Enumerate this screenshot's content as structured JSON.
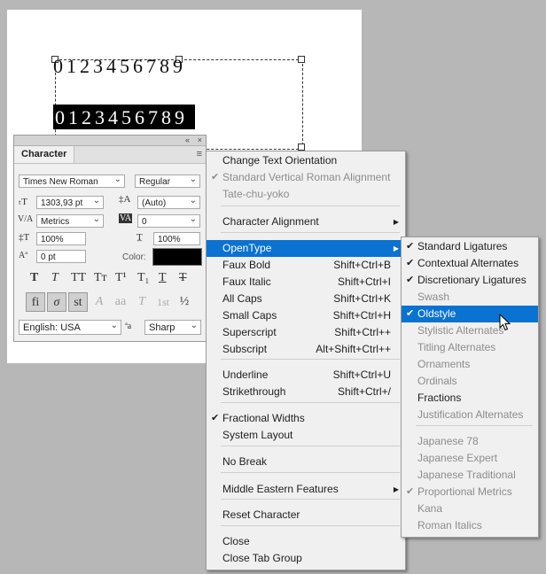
{
  "canvas": {
    "digits_top": "0123456789",
    "digits_highlight": "0123456789"
  },
  "panel": {
    "title": "Character",
    "collapse_glyph": "«",
    "close_glyph": "×",
    "menu_glyph": "≡",
    "font_family": "Times New Roman",
    "font_style": "Regular",
    "font_size": "1303,93 pt",
    "leading": "(Auto)",
    "kerning": "Metrics",
    "tracking": "0",
    "vertical_scale": "100%",
    "horizontal_scale": "100%",
    "baseline_shift": "0 pt",
    "color_label": "Color:",
    "color_value": "#000000",
    "style_buttons": [
      "T",
      "T",
      "TT",
      "Tт",
      "T¹",
      "T₁",
      "T",
      "T"
    ],
    "ligature_buttons": [
      "fi",
      "σ",
      "st",
      "A",
      "aa",
      "T",
      "1st",
      "½"
    ],
    "language": "English: USA",
    "aa_icon": "ªa",
    "antialias": "Sharp"
  },
  "context_menu": {
    "items": [
      {
        "label": "Change Text Orientation",
        "shortcut": "",
        "checked": false,
        "disabled": false,
        "submenu": false
      },
      {
        "label": "Standard Vertical Roman Alignment",
        "shortcut": "",
        "checked": true,
        "disabled": true,
        "submenu": false
      },
      {
        "label": "Tate-chu-yoko",
        "shortcut": "",
        "checked": false,
        "disabled": true,
        "submenu": false
      },
      {
        "label": "Character Alignment",
        "shortcut": "",
        "checked": false,
        "disabled": false,
        "submenu": true
      },
      {
        "label": "OpenType",
        "shortcut": "",
        "checked": false,
        "disabled": false,
        "submenu": true,
        "highlighted": true
      },
      {
        "label": "Faux Bold",
        "shortcut": "Shift+Ctrl+B",
        "checked": false,
        "disabled": false,
        "submenu": false
      },
      {
        "label": "Faux Italic",
        "shortcut": "Shift+Ctrl+I",
        "checked": false,
        "disabled": false,
        "submenu": false
      },
      {
        "label": "All Caps",
        "shortcut": "Shift+Ctrl+K",
        "checked": false,
        "disabled": false,
        "submenu": false
      },
      {
        "label": "Small Caps",
        "shortcut": "Shift+Ctrl+H",
        "checked": false,
        "disabled": false,
        "submenu": false
      },
      {
        "label": "Superscript",
        "shortcut": "Shift+Ctrl++",
        "checked": false,
        "disabled": false,
        "submenu": false
      },
      {
        "label": "Subscript",
        "shortcut": "Alt+Shift+Ctrl++",
        "checked": false,
        "disabled": false,
        "submenu": false
      },
      {
        "label": "Underline",
        "shortcut": "Shift+Ctrl+U",
        "checked": false,
        "disabled": false,
        "submenu": false
      },
      {
        "label": "Strikethrough",
        "shortcut": "Shift+Ctrl+/",
        "checked": false,
        "disabled": false,
        "submenu": false
      },
      {
        "label": "Fractional Widths",
        "shortcut": "",
        "checked": true,
        "disabled": false,
        "submenu": false
      },
      {
        "label": "System Layout",
        "shortcut": "",
        "checked": false,
        "disabled": false,
        "submenu": false
      },
      {
        "label": "No Break",
        "shortcut": "",
        "checked": false,
        "disabled": false,
        "submenu": false
      },
      {
        "label": "Middle Eastern Features",
        "shortcut": "",
        "checked": false,
        "disabled": false,
        "submenu": true
      },
      {
        "label": "Reset Character",
        "shortcut": "",
        "checked": false,
        "disabled": false,
        "submenu": false
      },
      {
        "label": "Close",
        "shortcut": "",
        "checked": false,
        "disabled": false,
        "submenu": false
      },
      {
        "label": "Close Tab Group",
        "shortcut": "",
        "checked": false,
        "disabled": false,
        "submenu": false
      }
    ]
  },
  "opentype_menu": {
    "items": [
      {
        "label": "Standard Ligatures",
        "checked": true,
        "disabled": false
      },
      {
        "label": "Contextual Alternates",
        "checked": true,
        "disabled": false
      },
      {
        "label": "Discretionary Ligatures",
        "checked": true,
        "disabled": false
      },
      {
        "label": "Swash",
        "checked": false,
        "disabled": true
      },
      {
        "label": "Oldstyle",
        "checked": true,
        "disabled": false,
        "highlighted": true
      },
      {
        "label": "Stylistic Alternates",
        "checked": false,
        "disabled": true
      },
      {
        "label": "Titling Alternates",
        "checked": false,
        "disabled": true
      },
      {
        "label": "Ornaments",
        "checked": false,
        "disabled": true
      },
      {
        "label": "Ordinals",
        "checked": false,
        "disabled": true
      },
      {
        "label": "Fractions",
        "checked": false,
        "disabled": false
      },
      {
        "label": "Justification Alternates",
        "checked": false,
        "disabled": true
      },
      {
        "label": "Japanese 78",
        "checked": false,
        "disabled": true
      },
      {
        "label": "Japanese Expert",
        "checked": false,
        "disabled": true
      },
      {
        "label": "Japanese Traditional",
        "checked": false,
        "disabled": true
      },
      {
        "label": "Proportional Metrics",
        "checked": true,
        "disabled": true
      },
      {
        "label": "Kana",
        "checked": false,
        "disabled": true
      },
      {
        "label": "Roman Italics",
        "checked": false,
        "disabled": true
      }
    ]
  }
}
